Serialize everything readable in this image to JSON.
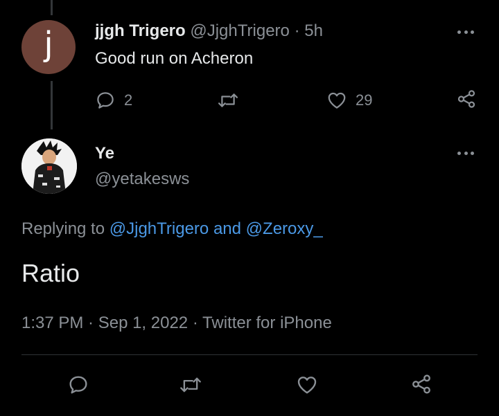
{
  "parent_tweet": {
    "avatar_letter": "j",
    "display_name": "jjgh Trigero",
    "handle": "@JjghTrigero",
    "separator": "·",
    "time": "5h",
    "text": "Good run on Acheron",
    "reply_count": "2",
    "like_count": "29"
  },
  "main_tweet": {
    "display_name": "Ye",
    "handle": "@yetakesws",
    "replying_prefix": "Replying to",
    "replying_user1": "@JjghTrigero",
    "replying_and": "and",
    "replying_user2": "@Zeroxy_",
    "text": "Ratio",
    "timestamp": "1:37 PM · Sep 1, 2022 · Twitter for iPhone"
  },
  "colors": {
    "background": "#000000",
    "text_primary": "#e7e9ea",
    "text_secondary": "#8b9096",
    "link": "#4b99e6",
    "avatar_j": "#6e4238"
  },
  "icons": [
    "reply-icon",
    "retweet-icon",
    "like-icon",
    "share-icon",
    "more-icon"
  ]
}
